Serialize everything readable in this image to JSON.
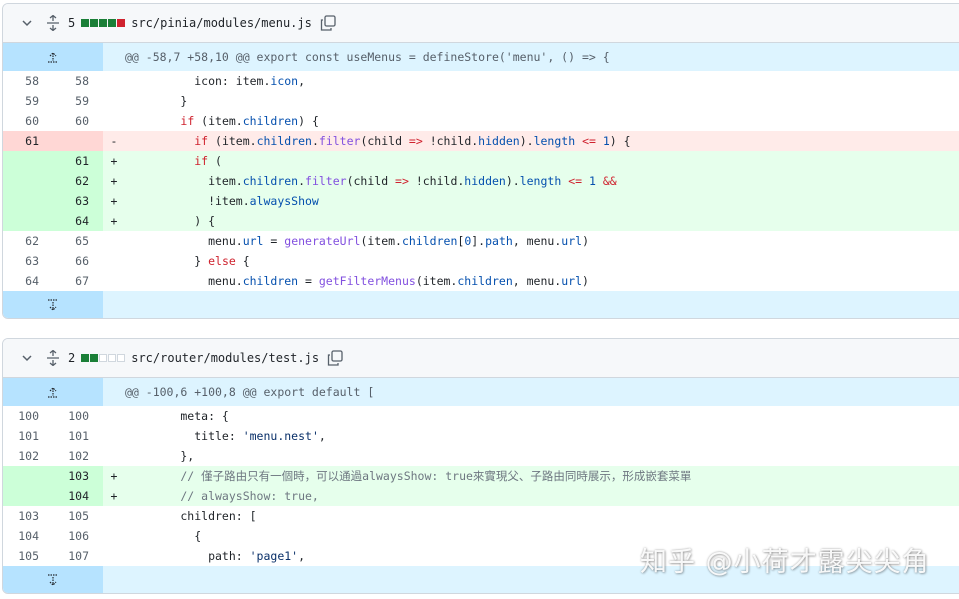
{
  "files": [
    {
      "change_count": "5",
      "bars": [
        "#1a7f37",
        "#1a7f37",
        "#1a7f37",
        "#1a7f37",
        "#cf222e"
      ],
      "filename": "src/pinia/modules/menu.js",
      "hunk": "@@ -58,7 +58,10 @@ export const useMenus = defineStore('menu', () => {",
      "lines": [
        {
          "type": "ctx",
          "old": "58",
          "new": "58",
          "mark": "",
          "code": "          icon: item.icon,"
        },
        {
          "type": "ctx",
          "old": "59",
          "new": "59",
          "mark": "",
          "code": "        }"
        },
        {
          "type": "ctx",
          "old": "60",
          "new": "60",
          "mark": "",
          "code": "        if (item.children) {"
        },
        {
          "type": "del",
          "old": "61",
          "new": "",
          "mark": "-",
          "code": "          if (item.children.filter(child => !child.hidden).length <= 1) {"
        },
        {
          "type": "add",
          "old": "",
          "new": "61",
          "mark": "+",
          "code": "          if ("
        },
        {
          "type": "add",
          "old": "",
          "new": "62",
          "mark": "+",
          "code": "            item.children.filter(child => !child.hidden).length <= 1 &&"
        },
        {
          "type": "add",
          "old": "",
          "new": "63",
          "mark": "+",
          "code": "            !item.alwaysShow"
        },
        {
          "type": "add",
          "old": "",
          "new": "64",
          "mark": "+",
          "code": "          ) {"
        },
        {
          "type": "ctx",
          "old": "62",
          "new": "65",
          "mark": "",
          "code": "            menu.url = generateUrl(item.children[0].path, menu.url)"
        },
        {
          "type": "ctx",
          "old": "63",
          "new": "66",
          "mark": "",
          "code": "          } else {"
        },
        {
          "type": "ctx",
          "old": "64",
          "new": "67",
          "mark": "",
          "code": "            menu.children = getFilterMenus(item.children, menu.url)"
        }
      ]
    },
    {
      "change_count": "2",
      "bars": [
        "#1a7f37",
        "#1a7f37",
        "#ffffff",
        "#ffffff",
        "#ffffff"
      ],
      "filename": "src/router/modules/test.js",
      "hunk": "@@ -100,6 +100,8 @@ export default [",
      "lines": [
        {
          "type": "ctx",
          "old": "100",
          "new": "100",
          "mark": "",
          "code": "        meta: {"
        },
        {
          "type": "ctx",
          "old": "101",
          "new": "101",
          "mark": "",
          "code": "          title: 'menu.nest',"
        },
        {
          "type": "ctx",
          "old": "102",
          "new": "102",
          "mark": "",
          "code": "        },"
        },
        {
          "type": "add",
          "old": "",
          "new": "103",
          "mark": "+",
          "code": "        // 僅子路由只有一個時，可以通過alwaysShow: true來實現父、子路由同時展示，形成嵌套菜單"
        },
        {
          "type": "add",
          "old": "",
          "new": "104",
          "mark": "+",
          "code": "        // alwaysShow: true,"
        },
        {
          "type": "ctx",
          "old": "103",
          "new": "105",
          "mark": "",
          "code": "        children: ["
        },
        {
          "type": "ctx",
          "old": "104",
          "new": "106",
          "mark": "",
          "code": "          {"
        },
        {
          "type": "ctx",
          "old": "105",
          "new": "107",
          "mark": "",
          "code": "            path: 'page1',"
        }
      ]
    }
  ],
  "watermark": "知乎 @小荷才露尖尖角",
  "icons": {
    "collapse": "chevron-down-icon",
    "expand": "unfold-icon",
    "copy": "copy-icon",
    "expand_up": "expand-up-icon",
    "expand_down": "expand-down-icon"
  }
}
